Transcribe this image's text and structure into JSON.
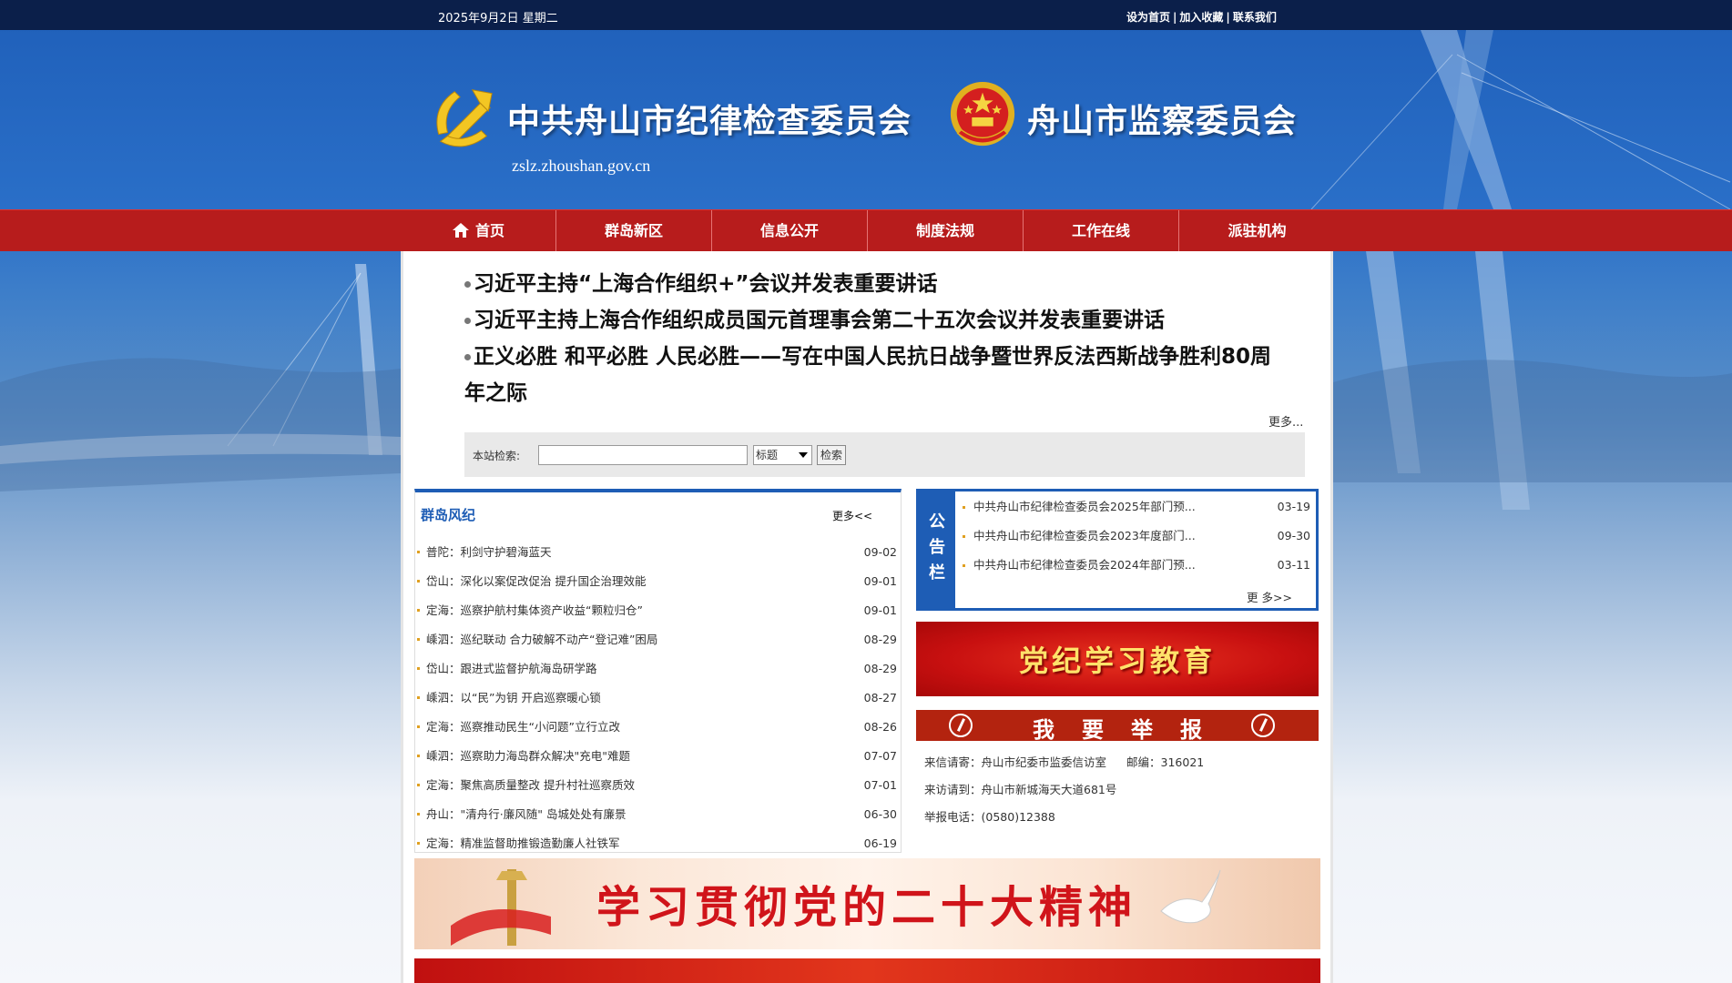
{
  "top_bar": {
    "date": "2025年9月2日 星期二",
    "links": [
      "设为首页",
      "加入收藏",
      "联系我们"
    ],
    "separator": "|"
  },
  "header": {
    "title_commission": "中共舟山市纪律检查委员会",
    "title_supervision": "舟山市监察委员会",
    "domain": "zslz.zhoushan.gov.cn"
  },
  "nav": {
    "items": [
      "首页",
      "群岛新区",
      "信息公开",
      "制度法规",
      "工作在线",
      "派驻机构"
    ]
  },
  "headlines": {
    "items": [
      "习近平主持“上海合作组织+”会议并发表重要讲话",
      "习近平主持上海合作组织成员国元首理事会第二十五次会议并发表重要讲话",
      "正义必胜 和平必胜 人民必胜——写在中国人民抗日战争暨世界反法西斯战争胜利80周",
      "年之际"
    ],
    "more": "更多..."
  },
  "search": {
    "label": "本站检索:",
    "input_value": "",
    "select_value": "标题",
    "button": "检索"
  },
  "news": {
    "title": "群岛风纪",
    "more": "更多<<",
    "items": [
      {
        "title": "普陀：利剑守护碧海蓝天",
        "date": "09-02"
      },
      {
        "title": "岱山：深化以案促改促治 提升国企治理效能",
        "date": "09-01"
      },
      {
        "title": "定海：巡察护航村集体资产收益“颗粒归仓”",
        "date": "09-01"
      },
      {
        "title": "嵊泗：巡纪联动 合力破解不动产“登记难”困局",
        "date": "08-29"
      },
      {
        "title": "岱山：跟进式监督护航海岛研学路",
        "date": "08-29"
      },
      {
        "title": "嵊泗：以“民”为钥 开启巡察暖心锁",
        "date": "08-27"
      },
      {
        "title": "定海：巡察推动民生“小问题”立行立改",
        "date": "08-26"
      },
      {
        "title": "嵊泗：巡察助力海岛群众解决\"充电\"难题",
        "date": "07-07"
      },
      {
        "title": "定海：聚焦高质量整改 提升村社巡察质效",
        "date": "07-01"
      },
      {
        "title": "舟山：\"清舟行·廉风随\" 岛城处处有廉景",
        "date": "06-30"
      },
      {
        "title": "定海：精准监督助推锻造勤廉人社铁军",
        "date": "06-19"
      }
    ]
  },
  "notice": {
    "label": [
      "公",
      "告",
      "栏"
    ],
    "items": [
      {
        "title": "中共舟山市纪律检查委员会2025年部门预...",
        "date": "03-19"
      },
      {
        "title": "中共舟山市纪律检查委员会2023年度部门...",
        "date": "09-30"
      },
      {
        "title": "中共舟山市纪律检查委员会2024年部门预...",
        "date": "03-11"
      }
    ],
    "more": "更 多>>"
  },
  "banners": {
    "study": "党纪学习教育",
    "report": "我要举报",
    "twenty": "学习贯彻党的二十大精神"
  },
  "contact": {
    "letters": "来信请寄：舟山市纪委市监委信访室",
    "postcode": "邮编：316021",
    "visits": "来访请到：舟山市新城海天大道681号",
    "phone": "举报电话：(0580)12388"
  },
  "colors": {
    "top_bar": "#0b1f4a",
    "nav_red": "#b71c1c",
    "accent_blue": "#1e5db5",
    "bullet_gold": "#e0a020"
  }
}
